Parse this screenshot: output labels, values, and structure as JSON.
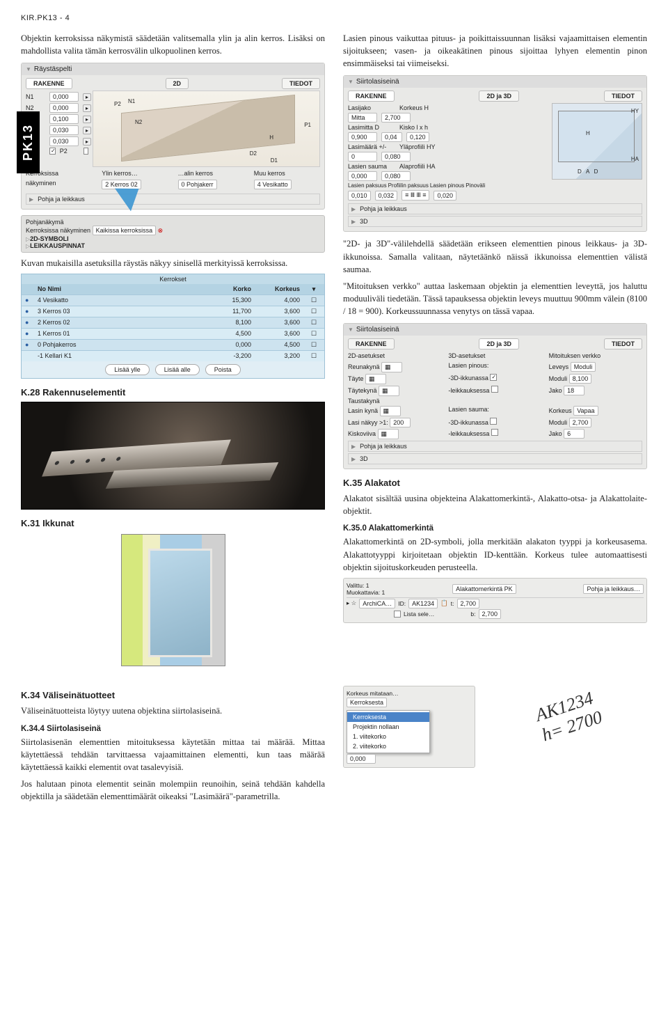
{
  "header": "KIR.PK13 - 4",
  "side_tag": "PK13",
  "left": {
    "p1": "Objektin kerroksissa näkymistä säädetään valitsemalla ylin ja alin kerros. Lisäksi on mahdollista valita tämän kerrosvälin ulkopuolinen kerros.",
    "panel1": {
      "title": "Räystäspelti",
      "tab1": "RAKENNE",
      "tab2": "2D",
      "tab3": "TIEDOT",
      "rows": [
        {
          "l": "N1",
          "v": "0,000"
        },
        {
          "l": "N2",
          "v": "0,000"
        },
        {
          "l": "H",
          "v": "0,100"
        },
        {
          "l": "D1",
          "v": "0,030"
        },
        {
          "l": "D2",
          "v": "0,030"
        }
      ],
      "p_row": {
        "p1": "P1",
        "p2": "P2"
      },
      "kerr_head": [
        "Kerroksissa",
        "Ylin kerros…",
        "…alin kerros",
        "Muu kerros"
      ],
      "kerr_vals": [
        "näkyminen",
        "2 Kerros 02",
        "0 Pohjakerr",
        "4 Vesikatto"
      ],
      "pohja": "Pohja ja leikkaus"
    },
    "panel2": {
      "rows": [
        "Pohjanäkymä",
        "Kerroksissa näkyminen",
        "2D-SYMBOLI",
        "LEIKKAUSPINNAT"
      ],
      "right": "Kaikissa kerroksissa"
    },
    "p2": "Kuvan mukaisilla asetuksilla räystäs näkyy sinisellä merkityissä kerroksissa.",
    "table": {
      "title": "Kerrokset",
      "head": [
        "No Nimi",
        "Korko",
        "Korkeus"
      ],
      "rows": [
        {
          "b": "●",
          "n": "4 Vesikatto",
          "k1": "15,300",
          "k2": "4,000"
        },
        {
          "b": "●",
          "n": "3 Kerros 03",
          "k1": "11,700",
          "k2": "3,600"
        },
        {
          "b": "●",
          "n": "2 Kerros 02",
          "k1": "8,100",
          "k2": "3,600"
        },
        {
          "b": "●",
          "n": "1 Kerros 01",
          "k1": "4,500",
          "k2": "3,600"
        },
        {
          "b": "●",
          "n": "0 Pohjakerros",
          "k1": "0,000",
          "k2": "4,500"
        },
        {
          "b": "",
          "n": "-1 Kellari K1",
          "k1": "-3,200",
          "k2": "3,200"
        }
      ],
      "btns": [
        "Lisää ylle",
        "Lisää alle",
        "Poista"
      ]
    },
    "sec28": "K.28   Rakennuselementit",
    "sec31": "K.31   Ikkunat"
  },
  "right": {
    "p1": "Lasien pinous vaikuttaa pituus- ja poikittaissuunnan lisäksi vajaamittaisen elementin sijoitukseen; vasen- ja oikeakätinen pinous sijoittaa lyhyen elementin pinon ensimmäiseksi tai viimeiseksi.",
    "siirto": {
      "title": "Siirtolasiseinä",
      "tab1": "RAKENNE",
      "tab2": "2D ja 3D",
      "tab3": "TIEDOT",
      "labels": {
        "lasijako": "Lasijako",
        "korkeus": "Korkeus H",
        "mitta": "Mitta",
        "mitta_v": "2,700",
        "lasimitta": "Lasimitta D",
        "kisko": "Kisko l x h",
        "lasimitta_v": "0,900",
        "kisko_v1": "0,04",
        "kisko_v2": "0,120",
        "lasimaara": "Lasimäärä +/-",
        "yla": "Yläprofiili HY",
        "lasimaara_v": "0",
        "yla_v": "0,080",
        "sauma": "Lasien sauma",
        "ala": "Alaprofiili HA",
        "sauma_v": "0,000",
        "ala_v": "0,080",
        "paksuus": "Lasien paksuus",
        "prof": "Profiilin paksuus",
        "pinous": "Lasien pinous",
        "pinovali": "Pinoväli",
        "paksuus_v": "0,010",
        "prof_v": "0,032",
        "pinovali_v": "0,020"
      },
      "pohja": "Pohja ja leikkaus",
      "d3": "3D"
    },
    "p2a": "\"2D- ja 3D\"-välilehdellä säädetään erikseen elementtien pinous leikkaus- ja 3D-ikkunoissa. Samalla valitaan, näytetäänkö näissä ikkunoissa elementtien välistä saumaa.",
    "p2b": "\"Mitoituksen verkko\" auttaa laskemaan objektin ja elementtien leveyttä, jos haluttu moduuliväli tiedetään. Tässä tapauksessa objektin leveys muuttuu 900mm välein (8100 / 18 = 900). Korkeussuunnassa venytys on tässä vapaa.",
    "siirto2": {
      "title": "Siirtolasiseinä",
      "tab1": "RAKENNE",
      "tab2": "2D ja 3D",
      "tab3": "TIEDOT",
      "hd": [
        "2D-asetukset",
        "3D-asetukset",
        "Mitoituksen verkko"
      ],
      "rows": [
        [
          "Reunakynä",
          "Lasien pinous:",
          "Leveys",
          "Moduli"
        ],
        [
          "Täyte",
          "-3D-ikkunassa",
          "Moduli",
          "8,100"
        ],
        [
          "Täytekynä",
          "-leikkauksessa",
          "Jako",
          "18"
        ],
        [
          "Taustakynä",
          "",
          "",
          ""
        ],
        [
          "Lasin kynä",
          "Lasien sauma:",
          "Korkeus",
          "Vapaa"
        ],
        [
          "Lasi näkyy >1:",
          "-3D-ikkunassa",
          "Moduli",
          "2,700"
        ],
        [
          "Kiskoviiva",
          "-leikkauksessa",
          "Jako",
          "6"
        ]
      ],
      "lasi_v": "200",
      "pohja": "Pohja ja leikkaus",
      "d3": "3D"
    },
    "sec35": "K.35   Alakatot",
    "p35": "Alakatot sisältää uusina objekteina Alakattomerkintä-, Alakatto-otsa- ja Alakattolaite-objektit.",
    "sec350": "K.35.0  Alakattomerkintä",
    "p350": "Alakattomerkintä on 2D-symboli, jolla merkitään alakaton tyyppi ja korkeusasema. Alakattotyyppi kirjoitetaan objektin ID-kenttään. Korkeus tulee automaattisesti objektin sijoituskorkeuden perusteella.",
    "mini": {
      "title": "Alakattomerkintä PK",
      "valittu": "Valittu: 1",
      "muok": "Muokattavia: 1",
      "pohja": "Pohja ja leikkaus…",
      "arch": "ArchiCA…",
      "id": "ID:",
      "id_v": "AK1234",
      "lista": "Lista sele…",
      "t": "t:",
      "t_v": "2,700",
      "b": "b:",
      "b_v": "2,700"
    }
  },
  "footer": {
    "sec34": "K.34   Väliseinätuotteet",
    "p34": "Väliseinätuotteista löytyy uutena objektina siirtolasiseinä.",
    "sec344": "K.34.4  Siirtolasiseinä",
    "p344a": "Siirtolasisenän elementtien mitoituksessa käytetään mittaa tai määrää. Mittaa käytettäessä tehdään tarvittaessa vajaamittainen elementti, kun taas määrää käytettäessä kaikki elementit ovat tasalevyisiä.",
    "p344b": "Jos halutaan pinota elementit seinän molempiin reunoihin, seinä tehdään kahdella objektilla ja säädetään elementtimäärät oikeaksi \"Lasimäärä\"-parametrilla.",
    "korkeus": {
      "title": "Korkeus mitataan…",
      "opts": [
        "Kerroksesta",
        "Projektin nollaan",
        "1. viitekorko",
        "2. viitekorko"
      ],
      "sel": "Kerroksesta",
      "val": "0,000"
    },
    "ak": "AK1234",
    "ak_h": "h= 2700"
  }
}
